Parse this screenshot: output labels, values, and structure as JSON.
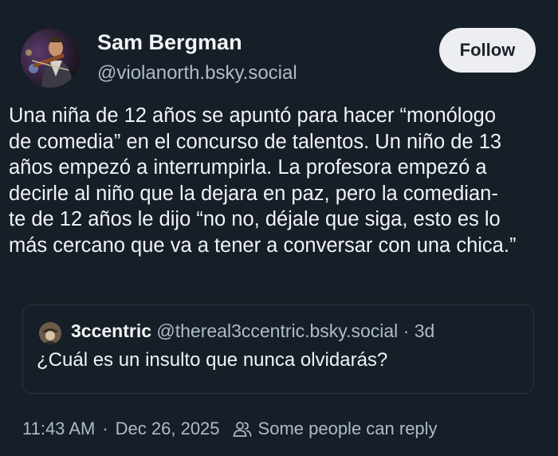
{
  "author": {
    "name": "Sam Bergman",
    "handle": "@violanorth.bsky.social"
  },
  "follow_label": "Follow",
  "post_lines": [
    "Una niña de 12 años se apuntó para hacer “monólogo",
    "de comedia” en el concurso de talentos. Un niño de 13",
    "años empezó a interrumpirla. La profesora empezó a",
    "decirle al niño que la dejara en paz, pero la comedian-",
    "te de 12 años le dijo “no no, déjale que siga, esto es lo",
    "más cercano que va a tener a conversar con una chica.”"
  ],
  "quoted": {
    "name": "3ccentric",
    "handle": "@thereal3ccentric.bsky.social",
    "separator": "·",
    "age": "3d",
    "text": "¿Cuál es un insulto que nunca olvidarás?"
  },
  "footer": {
    "time": "11:43 AM",
    "separator": "·",
    "date": "Dec 26, 2025",
    "reply_setting": "Some people can reply",
    "icon": "people-icon"
  }
}
